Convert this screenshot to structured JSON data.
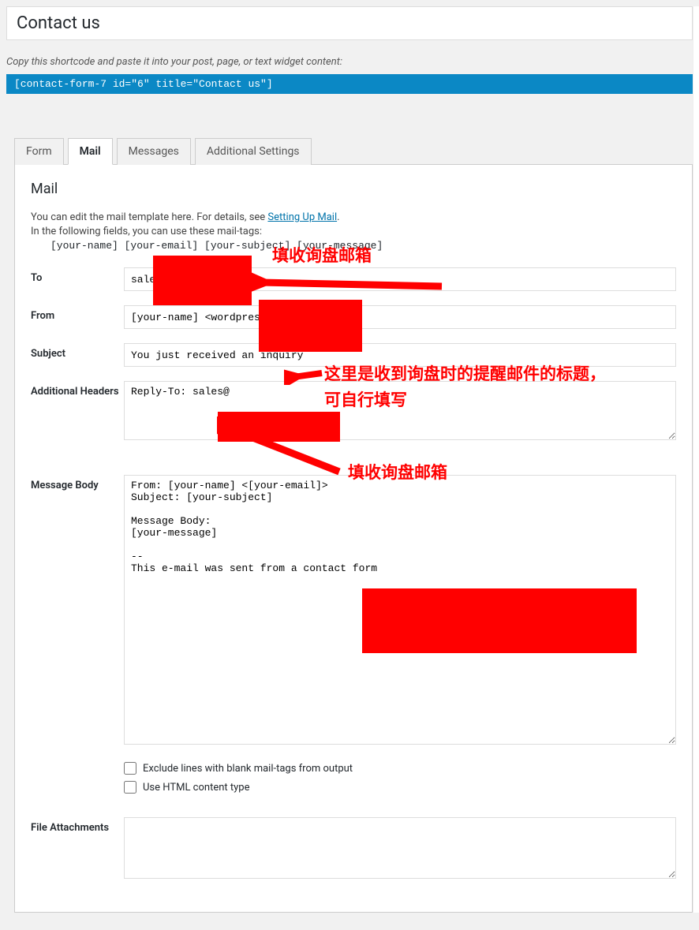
{
  "title": "Contact us",
  "shortcode_desc": "Copy this shortcode and paste it into your post, page, or text widget content:",
  "shortcode": "[contact-form-7 id=\"6\" title=\"Contact us\"]",
  "tabs": {
    "form": "Form",
    "mail": "Mail",
    "messages": "Messages",
    "additional": "Additional Settings"
  },
  "panel": {
    "heading": "Mail",
    "desc1": "You can edit the mail template here. For details, see ",
    "desc1_link": "Setting Up Mail",
    "desc1_after": ".",
    "desc2": "In the following fields, you can use these mail-tags:",
    "mail_tags": "[your-name] [your-email] [your-subject] [your-message]"
  },
  "labels": {
    "to": "To",
    "from": "From",
    "subject": "Subject",
    "additional_headers": "Additional Headers",
    "message_body": "Message Body",
    "file_attachments": "File Attachments"
  },
  "fields": {
    "to": "sales@",
    "from": "[your-name] <wordpress@",
    "subject": "You just received an inquiry",
    "additional_headers": "Reply-To: sales@",
    "message_body": "From: [your-name] <[your-email]>\nSubject: [your-subject]\n\nMessage Body:\n[your-message]\n\n-- \nThis e-mail was sent from a contact form",
    "file_attachments": ""
  },
  "checkboxes": {
    "exclude_blank": "Exclude lines with blank mail-tags from output",
    "use_html": "Use HTML content type"
  },
  "annotations": {
    "a1": "填收询盘邮箱",
    "a2_line1": "这里是收到询盘时的提醒邮件的标题，",
    "a2_line2": "可自行填写",
    "a3": "填收询盘邮箱"
  }
}
